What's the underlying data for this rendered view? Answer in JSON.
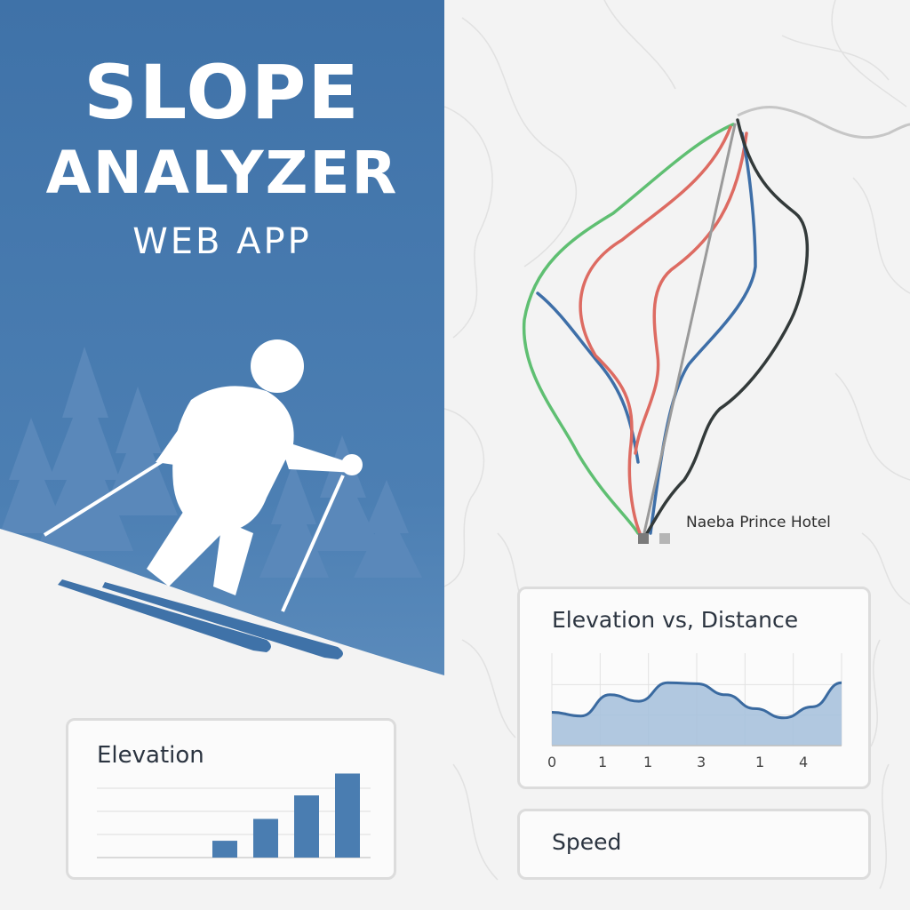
{
  "header": {
    "title_line1": "SLOPE",
    "title_line2": "ANALYZER",
    "title_line3": "WEB APP"
  },
  "map": {
    "hotel_label": "Naeba Prince Hotel"
  },
  "colors": {
    "brand_blue": "#4a7db1",
    "run_green": "#5fbf72",
    "run_red": "#dd6b62",
    "run_blue": "#3e6fa8",
    "run_black": "#333a3a",
    "lift_gray": "#9a9a9a",
    "chart_fill": "#a9c2dd",
    "chart_line": "#3a6aa0"
  },
  "elevation_card": {
    "title": "Elevation"
  },
  "profile_card": {
    "title": "Elevation vs, Distance",
    "x_ticks": [
      "0",
      "1",
      "1",
      "3",
      "1",
      "4"
    ]
  },
  "speed_card": {
    "title": "Speed"
  },
  "chart_data": [
    {
      "type": "bar",
      "title": "Elevation",
      "categories": [
        "",
        "",
        "",
        ""
      ],
      "values": [
        20,
        46,
        74,
        100
      ],
      "ylim": [
        0,
        110
      ],
      "grid": true
    },
    {
      "type": "area",
      "title": "Elevation vs, Distance",
      "x": [
        0,
        0.5,
        1,
        1.5,
        2,
        2.5,
        3,
        3.5,
        4,
        4.5,
        5
      ],
      "values": [
        36,
        32,
        55,
        48,
        68,
        67,
        55,
        40,
        30,
        42,
        68
      ],
      "ylim": [
        0,
        100
      ],
      "grid": true
    }
  ]
}
